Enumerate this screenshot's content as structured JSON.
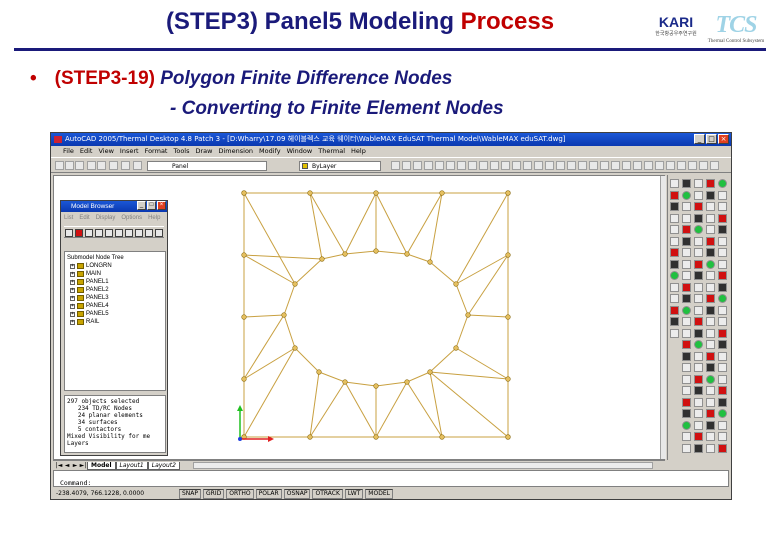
{
  "slide": {
    "title_main": "(STEP3) Panel5 Modeling ",
    "title_accent": "Process",
    "bullet_step": "(STEP3-19)",
    "bullet_text": " Polygon Finite Difference Nodes",
    "sub_text": "- Converting to Finite Element Nodes",
    "logo_left": "KARI",
    "logo_left_sub": "한국항공우주연구원",
    "logo_right": "TCS",
    "logo_right_sub": "Thermal Control Subsystem",
    "colors": {
      "title": "#1a1a7a",
      "accent": "#c00000"
    }
  },
  "window": {
    "title": "AutoCAD 2005/Thermal Desktop 4.8 Patch 3 - [D:Wharry\\17.09 헤이블렉스 교육 웨이터\\WableMAX EduSAT Thermal Model\\WableMAX eduSAT.dwg]",
    "menu": [
      "File",
      "Edit",
      "View",
      "Insert",
      "Format",
      "Tools",
      "Draw",
      "Dimension",
      "Modify",
      "Window",
      "Thermal",
      "Help"
    ],
    "layer": "Panel",
    "bylayer": "ByLayer"
  },
  "browser": {
    "title": "Model Browser",
    "menu": [
      "List",
      "Edit",
      "Display",
      "Options",
      "Help"
    ],
    "tree_header": "Submodel Node Tree",
    "tree_items": [
      "LONGRN",
      "MAIN",
      "PANEL1",
      "PANEL2",
      "PANEL3",
      "PANEL4",
      "PANEL5",
      "RAIL"
    ],
    "info": "297 objects selected\n   234 TD/RC Nodes\n   24 planar elements\n   34 surfaces\n   5 contactors\nMixed Visibility for me\nLayers"
  },
  "tabs": [
    "Model",
    "Layout1",
    "Layout2"
  ],
  "command": "Command:",
  "status": {
    "coords": "-238.4079, 766.1228, 0.0000",
    "buttons": [
      "SNAP",
      "GRID",
      "ORTHO",
      "POLAR",
      "OSNAP",
      "OTRACK",
      "LWT",
      "MODEL"
    ]
  },
  "mesh_color": "#c8a040"
}
